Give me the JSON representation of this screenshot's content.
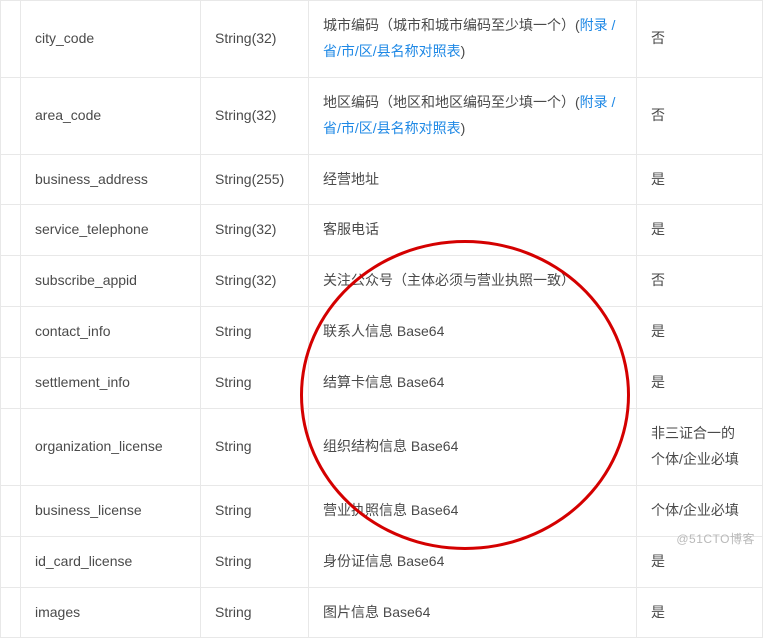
{
  "link_text": "附录 /省/市/区/县名称对照表",
  "watermark": "@51CTO博客",
  "rows": [
    {
      "param": "city_code",
      "type": "String(32)",
      "desc_prefix": "城市编码（城市和城市编码至少填一个）(",
      "desc_link": true,
      "desc_suffix": ")",
      "required": "否"
    },
    {
      "param": "area_code",
      "type": "String(32)",
      "desc_prefix": "地区编码（地区和地区编码至少填一个）(",
      "desc_link": true,
      "desc_suffix": ")",
      "required": "否"
    },
    {
      "param": "business_address",
      "type": "String(255)",
      "desc_prefix": "经营地址",
      "desc_link": false,
      "desc_suffix": "",
      "required": "是"
    },
    {
      "param": "service_telephone",
      "type": "String(32)",
      "desc_prefix": "客服电话",
      "desc_link": false,
      "desc_suffix": "",
      "required": "是"
    },
    {
      "param": "subscribe_appid",
      "type": "String(32)",
      "desc_prefix": "关注公众号（主体必须与营业执照一致）",
      "desc_link": false,
      "desc_suffix": "",
      "required": "否"
    },
    {
      "param": "contact_info",
      "type": "String",
      "desc_prefix": "联系人信息 Base64",
      "desc_link": false,
      "desc_suffix": "",
      "required": "是"
    },
    {
      "param": "settlement_info",
      "type": "String",
      "desc_prefix": "结算卡信息 Base64",
      "desc_link": false,
      "desc_suffix": "",
      "required": "是"
    },
    {
      "param": "organization_license",
      "type": "String",
      "desc_prefix": "组织结构信息 Base64",
      "desc_link": false,
      "desc_suffix": "",
      "required": "非三证合一的个体/企业必填"
    },
    {
      "param": "business_license",
      "type": "String",
      "desc_prefix": "营业执照信息 Base64",
      "desc_link": false,
      "desc_suffix": "",
      "required": "个体/企业必填"
    },
    {
      "param": "id_card_license",
      "type": "String",
      "desc_prefix": "身份证信息 Base64",
      "desc_link": false,
      "desc_suffix": "",
      "required": "是"
    },
    {
      "param": "images",
      "type": "String",
      "desc_prefix": "图片信息 Base64",
      "desc_link": false,
      "desc_suffix": "",
      "required": "是"
    }
  ]
}
